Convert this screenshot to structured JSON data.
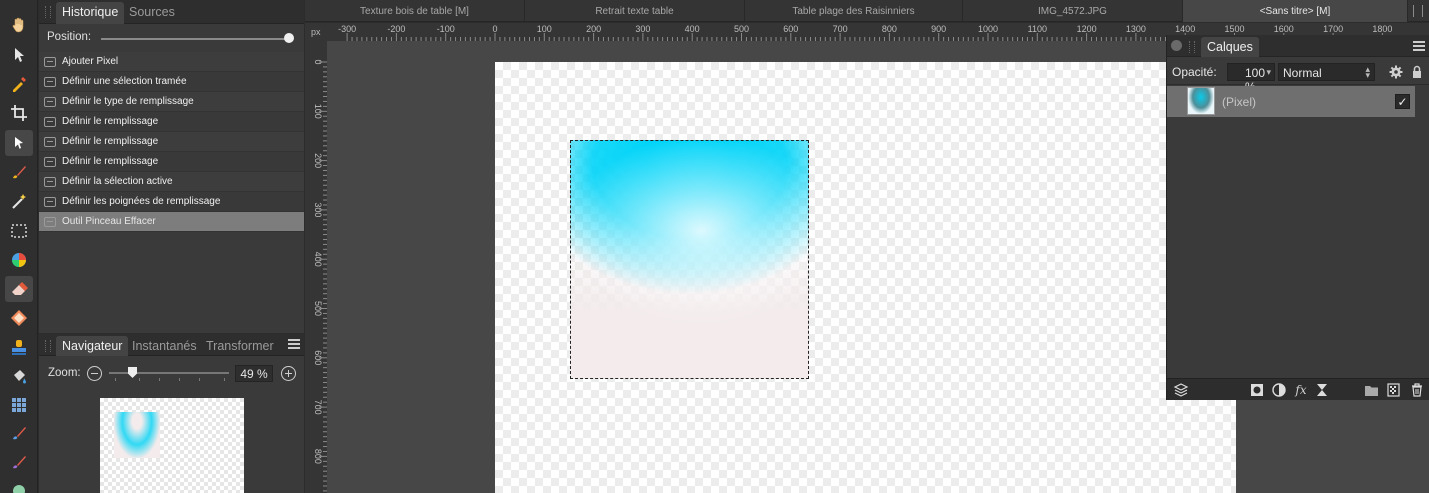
{
  "toolbar": {
    "tools": [
      "hand-icon",
      "move-icon",
      "color-picker-icon",
      "crop-icon",
      "selection-brush-icon",
      "paint-brush-icon",
      "magic-wand-icon",
      "marquee-icon",
      "color-wheel-icon",
      "eraser-icon",
      "fill-icon",
      "clone-stamp-icon",
      "flood-fill-icon",
      "mesh-icon",
      "smudge-icon",
      "dodge-icon",
      "blur-icon"
    ]
  },
  "history_panel": {
    "tabs": [
      "Historique",
      "Sources"
    ],
    "position_label": "Position:",
    "items": [
      "Ajouter Pixel",
      "Définir une sélection tramée",
      "Définir le type de remplissage",
      "Définir le remplissage",
      "Définir le remplissage",
      "Définir le remplissage",
      "Définir la sélection active",
      "Définir les poignées de remplissage",
      "Outil Pinceau Effacer"
    ]
  },
  "navigator_panel": {
    "tabs": [
      "Navigateur",
      "Instantanés",
      "Transformer"
    ],
    "zoom_label": "Zoom:",
    "zoom_value": "49 %"
  },
  "doc_tabs": [
    "Texture bois de table [M]",
    "Retrait texte table",
    "Table plage des Raisinniers",
    "IMG_4572.JPG",
    "<Sans titre> [M]"
  ],
  "ruler": {
    "unit": "px",
    "h_labels": [
      "-300",
      "-200",
      "-100",
      "0",
      "100",
      "200",
      "300",
      "400",
      "500",
      "600",
      "700",
      "800",
      "900",
      "1000",
      "1100",
      "1200",
      "1300",
      "1400",
      "1500",
      "1600",
      "1700",
      "1800"
    ],
    "v_labels": [
      "0",
      "100",
      "200",
      "300",
      "400",
      "500",
      "600",
      "700",
      "800"
    ]
  },
  "layers_panel": {
    "title": "Calques",
    "opacity_label": "Opacité:",
    "opacity_value": "100 %",
    "blend_mode": "Normal",
    "layer_name": "(Pixel)",
    "layer_check": "✓"
  },
  "colors": {
    "accent_cyan": "#00d4f8",
    "paper_pink": "#f3ebec",
    "panel_bg": "#3a3a3a",
    "canvas_bg": "#474747"
  }
}
